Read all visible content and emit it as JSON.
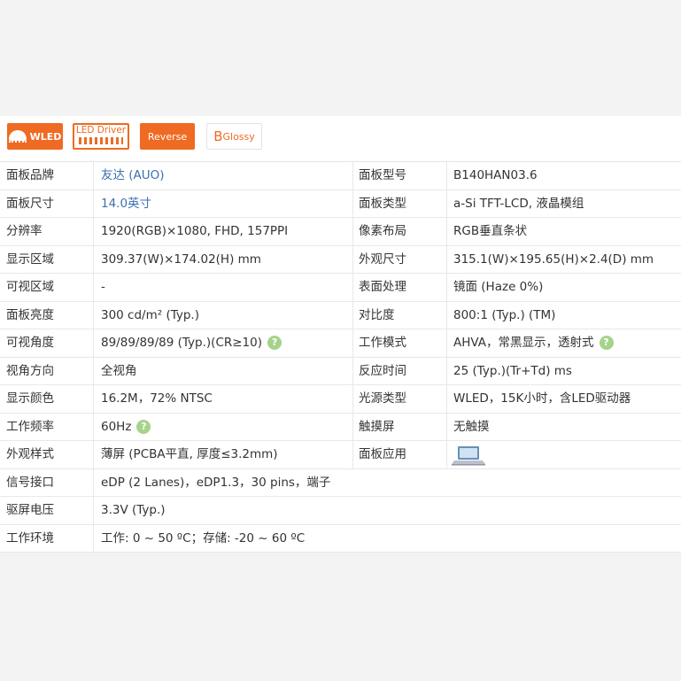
{
  "badges": {
    "wled": "WLED",
    "led_driver": "LED Driver",
    "reverse": "Reverse",
    "glossy_mark": "B",
    "glossy": "Glossy"
  },
  "rows": [
    {
      "k1": "面板品牌",
      "v1": "友达 (AUO)",
      "k2": "面板型号",
      "v2": "B140HAN03.6"
    },
    {
      "k1": "面板尺寸",
      "v1": "14.0英寸",
      "k2": "面板类型",
      "v2": "a-Si TFT-LCD, 液晶模组"
    },
    {
      "k1": "分辨率",
      "v1": "1920(RGB)×1080, FHD, 157PPI",
      "k2": "像素布局",
      "v2": "RGB垂直条状"
    },
    {
      "k1": "显示区域",
      "v1": "309.37(W)×174.02(H) mm",
      "k2": "外观尺寸",
      "v2": "315.1(W)×195.65(H)×2.4(D) mm"
    },
    {
      "k1": "可视区域",
      "v1": "-",
      "k2": "表面处理",
      "v2": "镜面 (Haze 0%)"
    },
    {
      "k1": "面板亮度",
      "v1": "300 cd/m² (Typ.)",
      "k2": "对比度",
      "v2": "800:1 (Typ.) (TM)"
    },
    {
      "k1": "可视角度",
      "v1": "89/89/89/89 (Typ.)(CR≥10)",
      "k2": "工作模式",
      "v2": "AHVA，常黑显示，透射式"
    },
    {
      "k1": "视角方向",
      "v1": "全视角",
      "k2": "反应时间",
      "v2": "25 (Typ.)(Tr+Td) ms"
    },
    {
      "k1": "显示颜色",
      "v1": "16.2M，72% NTSC",
      "k2": "光源类型",
      "v2": "WLED，15K小时，含LED驱动器"
    },
    {
      "k1": "工作频率",
      "v1": "60Hz",
      "k2": "触摸屏",
      "v2": "无触摸"
    },
    {
      "k1": "外观样式",
      "v1": "薄屏 (PCBA平直, 厚度≤3.2mm)",
      "k2": "面板应用",
      "v2": ""
    },
    {
      "k1": "信号接口",
      "v1": "eDP (2 Lanes)，eDP1.3，30 pins，端子"
    },
    {
      "k1": "驱屏电压",
      "v1": "3.3V (Typ.)"
    },
    {
      "k1": "工作环境",
      "v1": "工作: 0 ~ 50 ºC；存储: -20 ~ 60 ºC"
    }
  ],
  "help_glyph": "?",
  "application_icon": "laptop-icon"
}
